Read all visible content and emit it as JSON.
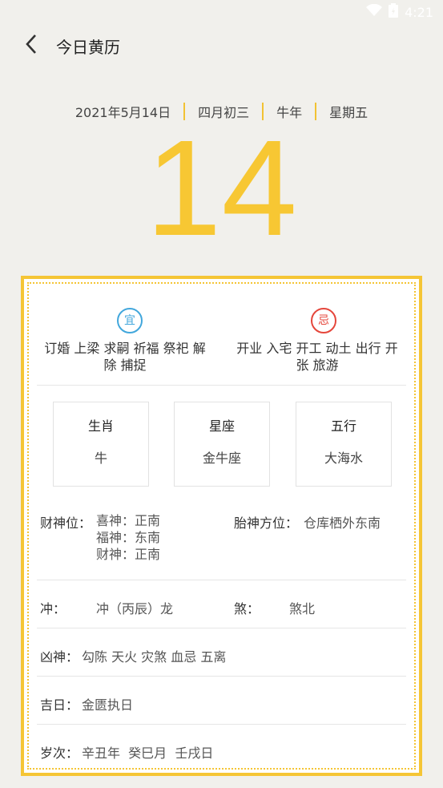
{
  "status": {
    "time": "4:21",
    "wifi_icon": "wifi-icon",
    "battery_icon": "battery-icon"
  },
  "header": {
    "title": "今日黄历",
    "back_icon": "back-arrow-icon"
  },
  "date": {
    "gregorian": "2021年5月14日",
    "lunar": "四月初三",
    "zodiac_year": "牛年",
    "weekday": "星期五",
    "day": "14"
  },
  "yi": {
    "icon_text": "宜",
    "items": "订婚 上梁 求嗣 祈福 祭祀 解\n除 捕捉"
  },
  "ji": {
    "icon_text": "忌",
    "items": "开业 入宅 开工 动土 出行 开\n张 旅游"
  },
  "cards": [
    {
      "label": "生肖",
      "value": "牛"
    },
    {
      "label": "星座",
      "value": "金牛座"
    },
    {
      "label": "五行",
      "value": "大海水"
    }
  ],
  "caishen": {
    "label": "财神位：",
    "xi": "喜神：正南",
    "fu": "福神：东南",
    "cai": "财神：正南"
  },
  "taishen": {
    "label": "胎神方位：",
    "value": "仓库栖外东南"
  },
  "chong": {
    "label": "冲：",
    "value": "冲（丙辰）龙"
  },
  "sha": {
    "label": "煞：",
    "value": "煞北"
  },
  "xiongshen": {
    "label": "凶神：",
    "value": "勾陈 天火 灾煞 血忌 五离"
  },
  "jiri": {
    "label": "吉日：",
    "value": "金匮执日"
  },
  "suici": {
    "label": "岁次：",
    "value": "辛丑年  癸巳月  壬戌日"
  },
  "colors": {
    "accent": "#f5c535",
    "yi": "#42a7dc",
    "ji": "#e5463b"
  }
}
